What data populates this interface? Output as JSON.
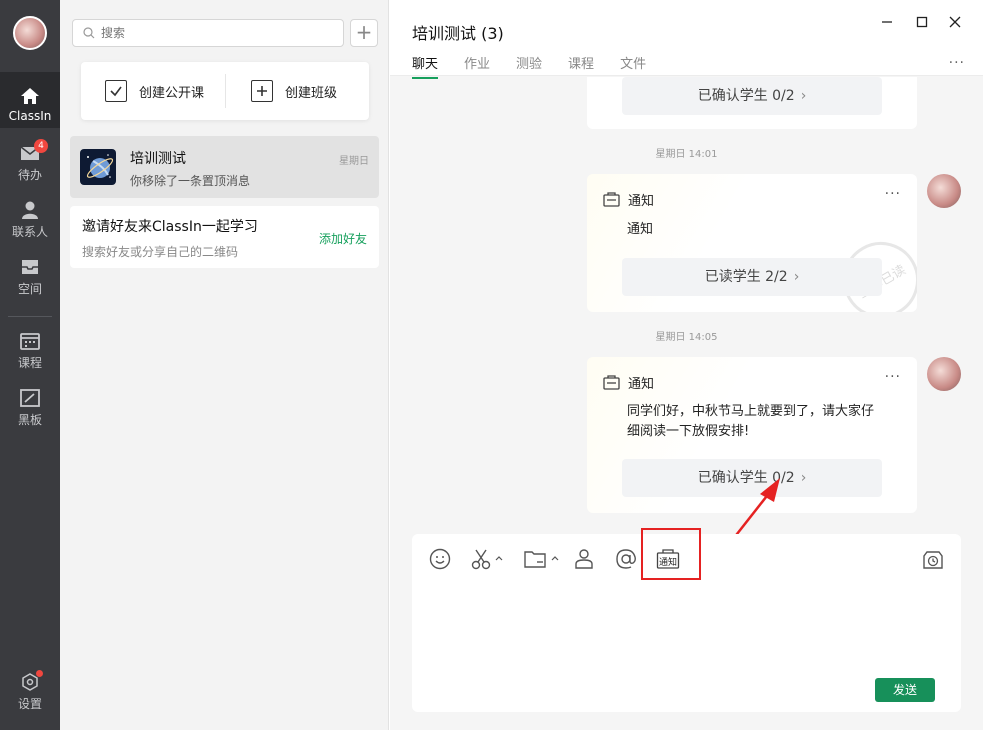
{
  "rail": {
    "items": [
      {
        "label": "ClassIn",
        "icon": "home-icon"
      },
      {
        "label": "待办",
        "icon": "inbox-icon",
        "badge": "4"
      },
      {
        "label": "联系人",
        "icon": "contact-icon"
      },
      {
        "label": "空间",
        "icon": "space-icon"
      },
      {
        "label": "课程",
        "icon": "calendar-icon"
      },
      {
        "label": "黑板",
        "icon": "blackboard-icon"
      },
      {
        "label": "设置",
        "icon": "gear-icon"
      }
    ]
  },
  "sidebar": {
    "search_placeholder": "搜索",
    "add_symbol": "+",
    "create_public_label": "创建公开课",
    "create_class_label": "创建班级",
    "conversations": [
      {
        "name": "培训测试",
        "preview": "你移除了一条置顶消息",
        "time": "星期日"
      }
    ],
    "invite": {
      "title": "邀请好友来ClassIn一起学习",
      "subtitle": "搜索好友或分享自己的二维码",
      "action": "添加好友"
    }
  },
  "chat": {
    "title": "培训测试 (3)",
    "tabs": [
      "聊天",
      "作业",
      "测验",
      "课程",
      "文件"
    ],
    "active_tab": 0,
    "messages": [
      {
        "status": "已确认学生 0/2"
      },
      {
        "time": "星期日 14:01",
        "type_label": "通知",
        "body": "通知",
        "status": "已读学生 2/2",
        "stamp": "全部已读"
      },
      {
        "time": "星期日 14:05",
        "type_label": "通知",
        "body": "同学们好，中秋节马上就要到了，请大家仔细阅读一下放假安排!",
        "status": "已确认学生 0/2"
      }
    ],
    "chevron": "›",
    "more_symbol": "···",
    "send_label": "发送",
    "notice_tool_label": "通知"
  },
  "colors": {
    "accent": "#17a05d",
    "rail_bg": "#3a3b3f",
    "badge": "#f0473f",
    "highlight": "#e52222"
  }
}
